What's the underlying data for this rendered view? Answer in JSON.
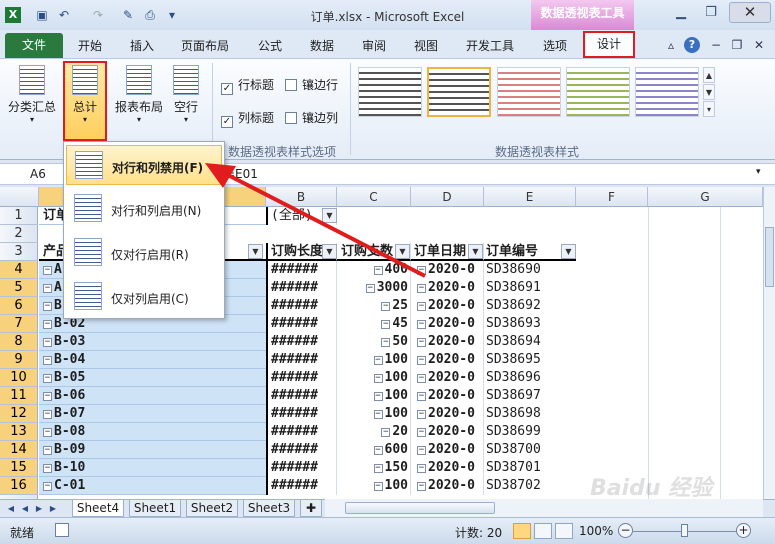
{
  "window": {
    "title": "订单.xlsx - Microsoft Excel",
    "context_tab": "数据透视表工具"
  },
  "tabs": [
    "文件",
    "开始",
    "插入",
    "页面布局",
    "公式",
    "数据",
    "审阅",
    "视图",
    "开发工具",
    "选项",
    "设计"
  ],
  "ribbon": {
    "layout_buttons": [
      "分类汇总",
      "总计",
      "报表布局",
      "空行"
    ],
    "checkboxes": [
      {
        "label": "行标题",
        "checked": true
      },
      {
        "label": "镶边行",
        "checked": false
      },
      {
        "label": "列标题",
        "checked": true
      },
      {
        "label": "镶边列",
        "checked": false
      }
    ],
    "groups": [
      "数据透视表样式选项",
      "数据透视表样式"
    ]
  },
  "formula_bar": {
    "name_box": "A6",
    "formula": "=E01"
  },
  "menu": {
    "items": [
      {
        "label": "对行和列禁用(F)"
      },
      {
        "label": "对行和列启用(N)"
      },
      {
        "label": "仅对行启用(R)"
      },
      {
        "label": "仅对列启用(C)"
      }
    ]
  },
  "grid": {
    "columns": [
      "A",
      "B",
      "C",
      "D",
      "E",
      "F",
      "G"
    ],
    "row1": {
      "a": "订单",
      "b": "(全部)"
    },
    "row3": {
      "a": "产品",
      "b": "订购长度",
      "c": "订购支数",
      "d": "订单日期",
      "e": "订单编号"
    },
    "rows": [
      {
        "n": "4",
        "a": "A-01",
        "b": "######",
        "c": "400",
        "d": "2020-0",
        "e": "SD38690"
      },
      {
        "n": "5",
        "a": "A-02",
        "b": "######",
        "c": "3000",
        "d": "2020-0",
        "e": "SD38691"
      },
      {
        "n": "6",
        "a": "B-01",
        "b": "######",
        "c": "25",
        "d": "2020-0",
        "e": "SD38692"
      },
      {
        "n": "7",
        "a": "B-02",
        "b": "######",
        "c": "45",
        "d": "2020-0",
        "e": "SD38693"
      },
      {
        "n": "8",
        "a": "B-03",
        "b": "######",
        "c": "50",
        "d": "2020-0",
        "e": "SD38694"
      },
      {
        "n": "9",
        "a": "B-04",
        "b": "######",
        "c": "100",
        "d": "2020-0",
        "e": "SD38695"
      },
      {
        "n": "10",
        "a": "B-05",
        "b": "######",
        "c": "100",
        "d": "2020-0",
        "e": "SD38696"
      },
      {
        "n": "11",
        "a": "B-06",
        "b": "######",
        "c": "100",
        "d": "2020-0",
        "e": "SD38697"
      },
      {
        "n": "12",
        "a": "B-07",
        "b": "######",
        "c": "100",
        "d": "2020-0",
        "e": "SD38698"
      },
      {
        "n": "13",
        "a": "B-08",
        "b": "######",
        "c": "20",
        "d": "2020-0",
        "e": "SD38699"
      },
      {
        "n": "14",
        "a": "B-09",
        "b": "######",
        "c": "600",
        "d": "2020-0",
        "e": "SD38700"
      },
      {
        "n": "15",
        "a": "B-10",
        "b": "######",
        "c": "150",
        "d": "2020-0",
        "e": "SD38701"
      },
      {
        "n": "16",
        "a": "C-01",
        "b": "######",
        "c": "100",
        "d": "2020-0",
        "e": "SD38702"
      }
    ]
  },
  "sheets": [
    "Sheet4",
    "Sheet1",
    "Sheet2",
    "Sheet3"
  ],
  "status": {
    "ready": "就绪",
    "count": "计数: 20",
    "zoom": "100%"
  },
  "watermark": "Baidu 经验",
  "colors": {
    "accent_red": "#e21c1c",
    "file_tab": "#2a7a3d",
    "selection": "#cfe3f7"
  }
}
